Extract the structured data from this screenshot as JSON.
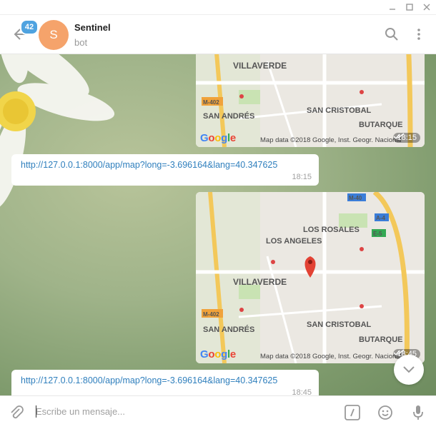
{
  "window": {
    "minimize_icon": "minimize-icon",
    "maximize_icon": "maximize-icon",
    "close_icon": "close-icon"
  },
  "header": {
    "unread_count": "42",
    "avatar_letter": "S",
    "title": "Sentinel",
    "subtitle": "bot",
    "avatar_color": "#f5a36b",
    "badge_color": "#4fa3e0"
  },
  "map": {
    "labels": {
      "villaverde": "VILLAVERDE",
      "san_andres": "SAN ANDRÉS",
      "san_cristobal": "SAN CRISTOBAL",
      "butarque": "BUTARQUE",
      "los_rosales": "LOS ROSALES",
      "los_angeles": "LOS ANGELES",
      "m402": "M-402",
      "m40": "M-40",
      "a4": "A-4",
      "e5": "E-5"
    },
    "google": "Google",
    "attribution": "Map data ©2018 Google, Inst. Geogr. Nacional"
  },
  "messages": [
    {
      "type": "map",
      "time": "18:15"
    },
    {
      "type": "text",
      "text": "http://127.0.0.1:8000/app/map?long=-3.696164&lang=40.347625",
      "time": "18:15"
    },
    {
      "type": "map",
      "time": "18:45"
    },
    {
      "type": "text",
      "text": "http://127.0.0.1:8000/app/map?long=-3.696164&lang=40.347625",
      "time": "18:45"
    }
  ],
  "composer": {
    "placeholder": "Escribe un mensaje..."
  },
  "colors": {
    "link": "#2f7fbd",
    "accent": "#4fa3e0"
  }
}
